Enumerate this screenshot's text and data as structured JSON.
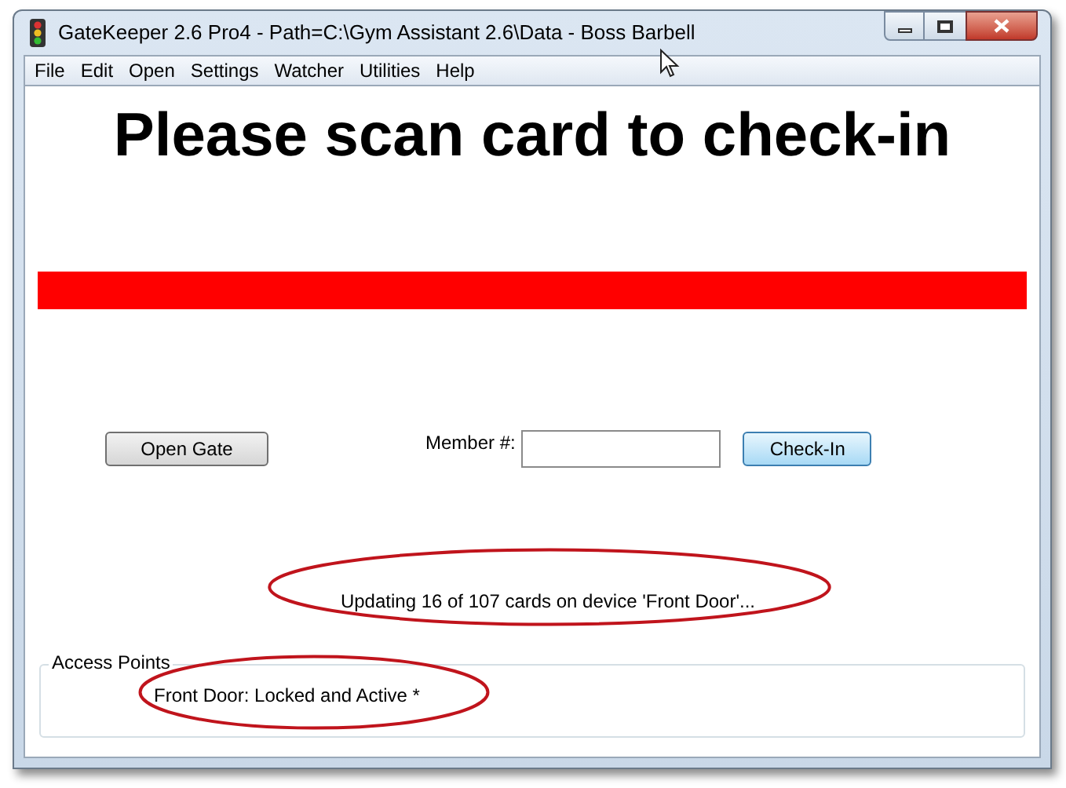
{
  "window": {
    "title": "GateKeeper 2.6 Pro4 - Path=C:\\Gym Assistant 2.6\\Data - Boss Barbell"
  },
  "menu": [
    "File",
    "Edit",
    "Open",
    "Settings",
    "Watcher",
    "Utilities",
    "Help"
  ],
  "heading": "Please scan card to check-in",
  "open_gate_button": "Open Gate",
  "member_field": {
    "label": "Member #:"
  },
  "check_in_button": "Check-In",
  "status": "Updating 16 of 107 cards on device 'Front Door'...",
  "access_points": {
    "title": "Access Points",
    "items": [
      "Front Door: Locked and Active *"
    ]
  }
}
